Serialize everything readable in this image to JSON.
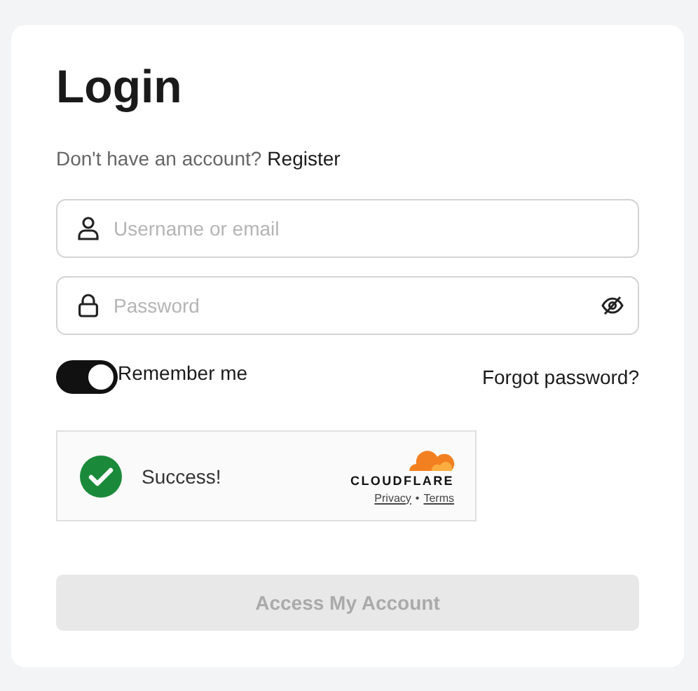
{
  "title": "Login",
  "signup_prompt": {
    "text": "Don't have an account?",
    "link": "Register"
  },
  "fields": [
    {
      "kind": "text",
      "placeholder": "Username or email"
    },
    {
      "kind": "password",
      "placeholder": "Password"
    }
  ],
  "remember": {
    "label": "Remember me",
    "on": true
  },
  "forgot_link": "Forgot password?",
  "captcha": {
    "success": true,
    "status": "Success!",
    "brand": "CLOUDFLARE",
    "links": [
      "Privacy",
      "Terms"
    ],
    "separator": "•"
  },
  "submit": {
    "label": "Access My Account",
    "disabled": true
  }
}
